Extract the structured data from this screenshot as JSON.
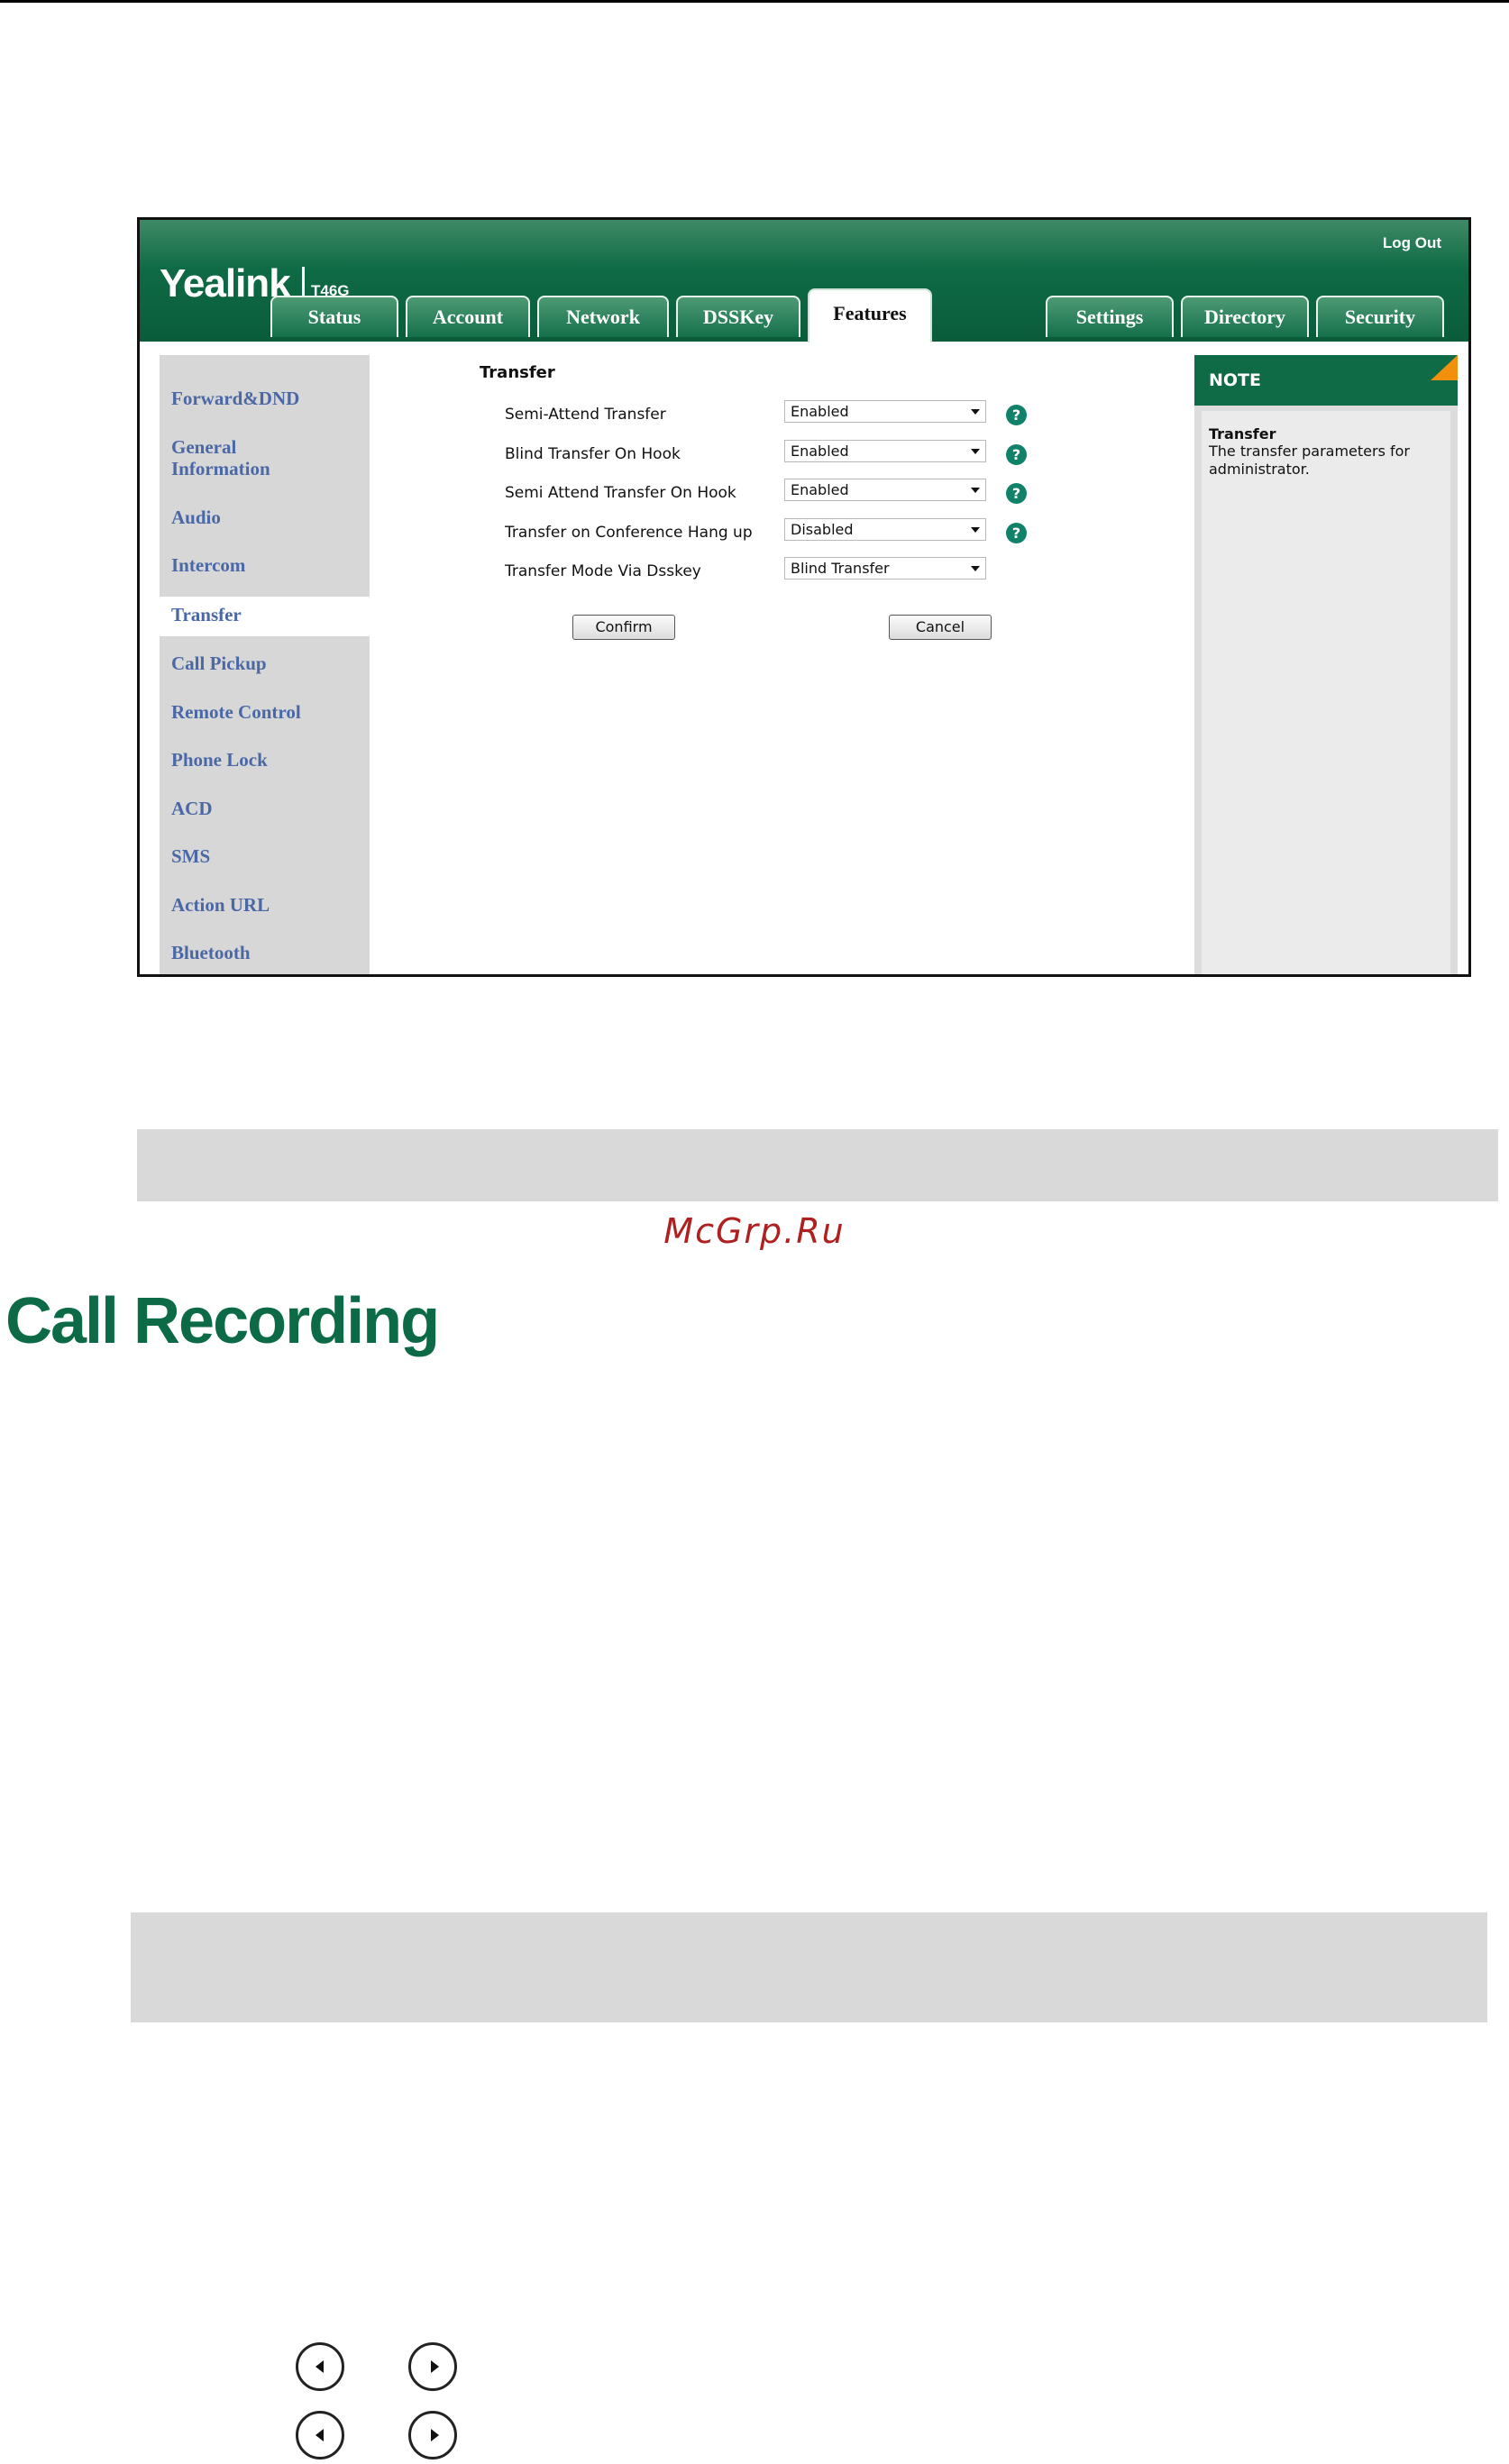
{
  "app": {
    "brand": "Yealink",
    "model": "T46G",
    "logout_label": "Log Out"
  },
  "tabs": [
    {
      "label": "Status"
    },
    {
      "label": "Account"
    },
    {
      "label": "Network"
    },
    {
      "label": "DSSKey"
    },
    {
      "label": "Features",
      "active": true
    },
    {
      "label": "Settings"
    },
    {
      "label": "Directory"
    },
    {
      "label": "Security"
    }
  ],
  "sidebar": {
    "items": [
      {
        "label": "Forward&DND"
      },
      {
        "label": "General Information"
      },
      {
        "label": "Audio"
      },
      {
        "label": "Intercom"
      },
      {
        "label": "Transfer",
        "active": true
      },
      {
        "label": "Call Pickup"
      },
      {
        "label": "Remote Control"
      },
      {
        "label": "Phone Lock"
      },
      {
        "label": "ACD"
      },
      {
        "label": "SMS"
      },
      {
        "label": "Action URL"
      },
      {
        "label": "Bluetooth"
      }
    ]
  },
  "form": {
    "section_title": "Transfer",
    "rows": [
      {
        "label": "Semi-Attend Transfer",
        "value": "Enabled",
        "help": true
      },
      {
        "label": "Blind Transfer On Hook",
        "value": "Enabled",
        "help": true
      },
      {
        "label": "Semi Attend Transfer On Hook",
        "value": "Enabled",
        "help": true
      },
      {
        "label": "Transfer on Conference Hang up",
        "value": "Disabled",
        "help": true
      },
      {
        "label": "Transfer Mode Via Dsskey",
        "value": "Blind Transfer",
        "help": false
      }
    ],
    "help_glyph": "?",
    "confirm_label": "Confirm",
    "cancel_label": "Cancel"
  },
  "note": {
    "header": "NOTE",
    "title": "Transfer",
    "text": "The transfer parameters for administrator."
  },
  "page": {
    "watermark": "McGrp.Ru",
    "heading": "Call Recording",
    "nav_icons": [
      "left-arrow-icon",
      "right-arrow-icon"
    ]
  },
  "colors": {
    "brand_green": "#0e6b45",
    "note_accent": "#f0900c",
    "sidebar_link": "#4a68a6",
    "help_icon": "#11826a",
    "heading": "#0c6a47",
    "watermark": "#b02020"
  }
}
